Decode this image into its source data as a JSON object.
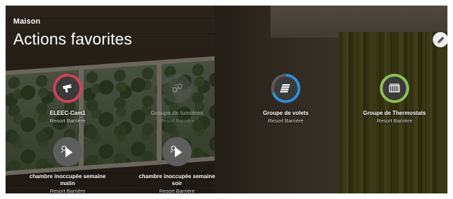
{
  "header": {
    "context": "Maison",
    "title": "Actions favorites"
  },
  "toolbar": {
    "edit_icon": "pencil-icon"
  },
  "colors": {
    "camera_ring": "#d43f58",
    "shutters_ring": "#2f8fd1",
    "thermostats_ring": "#8cc152",
    "disabled_ring": "#5c5c5c",
    "edit_button_bg": "#eeeeee"
  },
  "favorites": [
    {
      "title": "ELEEC-Cam1",
      "subtitle": "Resort Barrière",
      "icon": "camera-icon",
      "state": "active"
    },
    {
      "title": "Groupe de lumières",
      "subtitle": "Resort Barrière",
      "icon": "lights-group-icon",
      "state": "disabled"
    },
    {
      "title": "Groupe de volets",
      "subtitle": "Resort Barrière",
      "icon": "shutters-group-icon",
      "state": "active"
    },
    {
      "title": "Groupe de Thermostats",
      "subtitle": "Resort Barrière",
      "icon": "thermostats-group-icon",
      "state": "active"
    },
    {
      "title_line1": "chambre inoccupée semaine",
      "title_line2": "matin",
      "subtitle": "Resort Barrière",
      "icon": "scene-play-icon",
      "state": "active"
    },
    {
      "title_line1": "chambre inoccupée semaine",
      "title_line2": "soir",
      "subtitle": "Resort Barrière",
      "icon": "scene-play-icon",
      "state": "active"
    }
  ]
}
